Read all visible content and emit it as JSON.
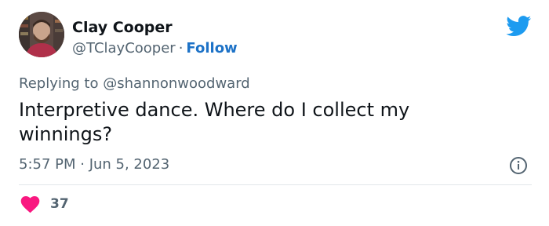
{
  "author": {
    "display_name": "Clay Cooper",
    "handle": "@TClayCooper",
    "separator": "·",
    "follow_label": "Follow"
  },
  "reply": {
    "prefix": "Replying to",
    "mention": "@shannonwoodward"
  },
  "tweet": {
    "text": "Interpretive dance. Where do I collect my winnings?",
    "timestamp": "5:57 PM · Jun 5, 2023"
  },
  "stats": {
    "likes": "37"
  },
  "colors": {
    "twitter_blue": "#1d9bf0",
    "like_pink": "#f91880",
    "follow_blue": "#1d72c7",
    "secondary_text": "#536471"
  },
  "icons": {
    "brand": "twitter-bird-icon",
    "info": "info-icon",
    "like": "heart-icon"
  }
}
